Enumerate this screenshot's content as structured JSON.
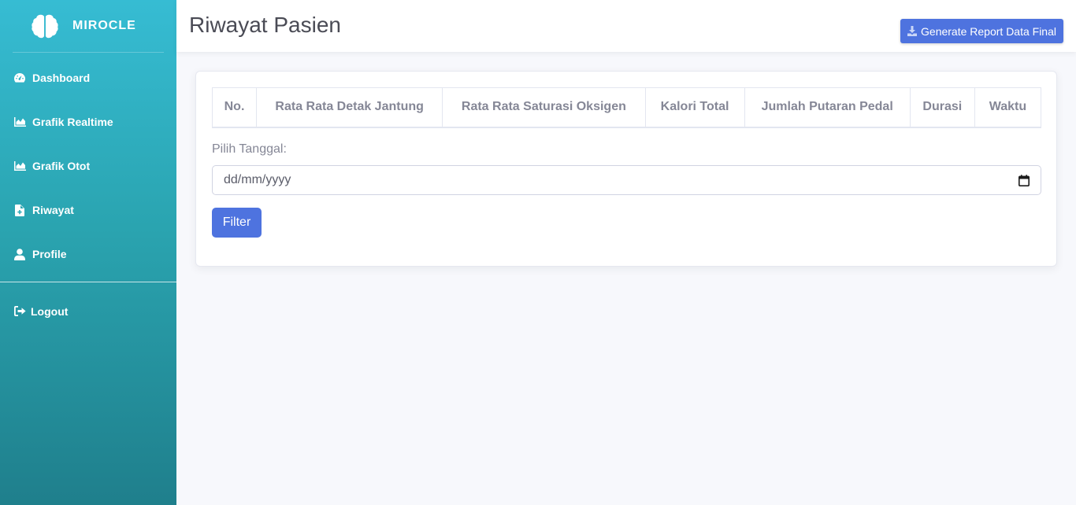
{
  "brand": {
    "name": "MIROCLE",
    "logo_icon": "brain-icon"
  },
  "sidebar": {
    "items": [
      {
        "label": "Dashboard",
        "icon": "gauge-icon"
      },
      {
        "label": "Grafik Realtime",
        "icon": "area-chart-icon"
      },
      {
        "label": "Grafik Otot",
        "icon": "area-chart-icon"
      },
      {
        "label": "Riwayat",
        "icon": "medical-file-icon"
      },
      {
        "label": "Profile",
        "icon": "user-icon"
      }
    ],
    "logout": {
      "label": "Logout",
      "icon": "sign-out-icon"
    }
  },
  "header": {
    "title": "Riwayat Pasien",
    "report_button": "Generate Report Data Final"
  },
  "table": {
    "columns": [
      "No.",
      "Rata Rata Detak Jantung",
      "Rata Rata Saturasi Oksigen",
      "Kalori Total",
      "Jumlah Putaran Pedal",
      "Durasi",
      "Waktu"
    ]
  },
  "filter": {
    "label": "Pilih Tanggal:",
    "date_value": "dd/mm/yyyy",
    "button": "Filter"
  },
  "colors": {
    "primary": "#4e73df",
    "sidebar_top": "#36bcd3",
    "sidebar_bottom": "#1f7f8c"
  }
}
